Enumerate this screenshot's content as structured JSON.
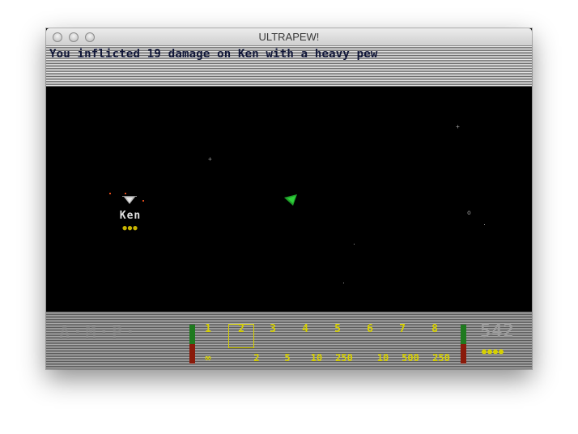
{
  "window": {
    "title": "ULTRAPEW!"
  },
  "message": "You inflicted 19 damage on Ken with a heavy pew",
  "enemy": {
    "name": "Ken",
    "health_pips": "●●●"
  },
  "hud": {
    "left_text": "A·M·P·",
    "weapon_slots": [
      {
        "label": "1",
        "ammo": "∞"
      },
      {
        "label": "2",
        "ammo": "2"
      },
      {
        "label": "3",
        "ammo": "5"
      },
      {
        "label": "4",
        "ammo": "10"
      },
      {
        "label": "5",
        "ammo": "250"
      },
      {
        "label": "6",
        "ammo": "10"
      },
      {
        "label": "7",
        "ammo": "500"
      },
      {
        "label": "8",
        "ammo": "250"
      }
    ],
    "selected_slot": 2,
    "score": "542",
    "score_sub": "●●●●"
  },
  "colors": {
    "message": "#101638",
    "hud_yellow": "#d6d000",
    "player_ship": "#1fa02a",
    "enemy_spark": "#e04a1a",
    "gauge_green": "#1f7a1f",
    "gauge_red": "#8a1a0a"
  },
  "icons": {
    "close": "window-close-icon",
    "minimize": "window-minimize-icon",
    "zoom": "window-zoom-icon",
    "player": "player-ship-icon",
    "enemy": "enemy-ship-icon"
  }
}
